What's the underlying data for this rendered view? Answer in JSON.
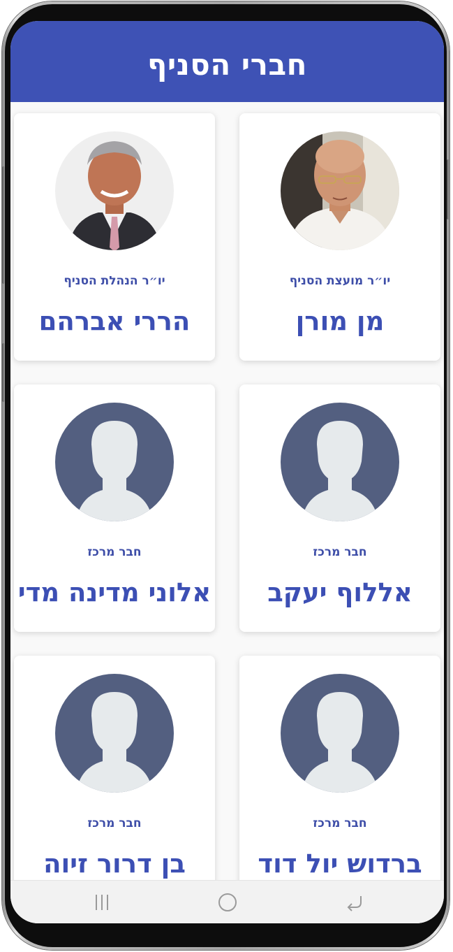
{
  "header": {
    "title": "חברי הסניף"
  },
  "members": [
    {
      "role": "יו״ר מועצת הסניף",
      "name": "מן מורן",
      "photo": "photo-man-glasses"
    },
    {
      "role": "יו״ר הנהלת הסניף",
      "name": "הררי אברהם",
      "photo": "photo-man-suit"
    },
    {
      "role": "חבר מרכז",
      "name": "אללוף יעקב",
      "photo": "default-avatar-icon"
    },
    {
      "role": "חבר מרכז",
      "name": "אלוני מדינה מדי",
      "photo": "default-avatar-icon"
    },
    {
      "role": "חבר מרכז",
      "name": "ברדוש יול דוד",
      "photo": "default-avatar-icon"
    },
    {
      "role": "חבר מרכז",
      "name": "בן דרור זיוה",
      "photo": "default-avatar-icon"
    }
  ],
  "navbar": {
    "back_icon": "back-arrow-icon",
    "home_icon": "home-circle-icon",
    "recents_icon": "recents-icon"
  },
  "colors": {
    "accent": "#3e52b5",
    "text_accent": "#3c4fb4",
    "avatar_bg": "#535f80",
    "avatar_silhouette": "#e6eaec"
  }
}
